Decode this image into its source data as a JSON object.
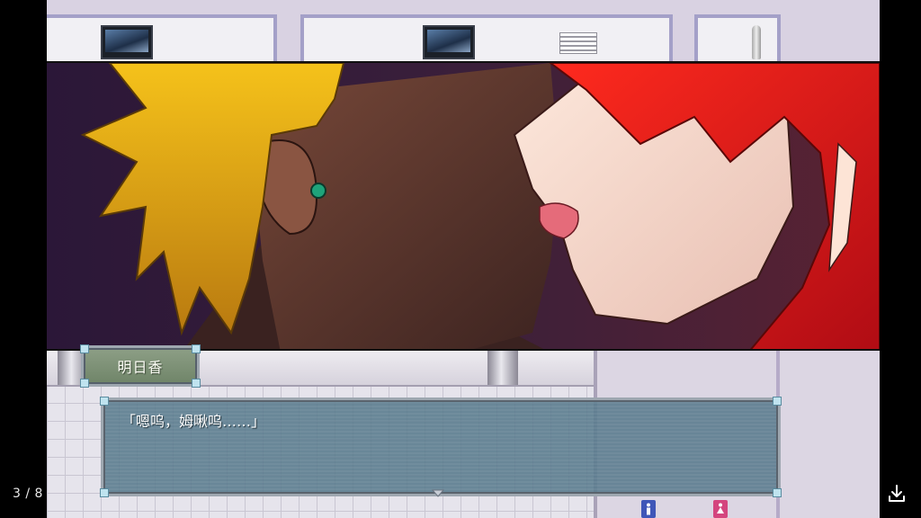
{
  "viewer": {
    "page_counter": "3 / 8",
    "icons": {
      "download": "download-icon",
      "wifi": "wifi-icon"
    }
  },
  "dialogue": {
    "speaker_name": "明日香",
    "message": "「嗯呜，姆啾呜……」"
  },
  "colors": {
    "name_plate": "#7b9074",
    "message_box": "#587a8c",
    "frame": "#9ea7b0",
    "red_hair": "#e8171a",
    "blonde_hair": "#e0a614"
  }
}
